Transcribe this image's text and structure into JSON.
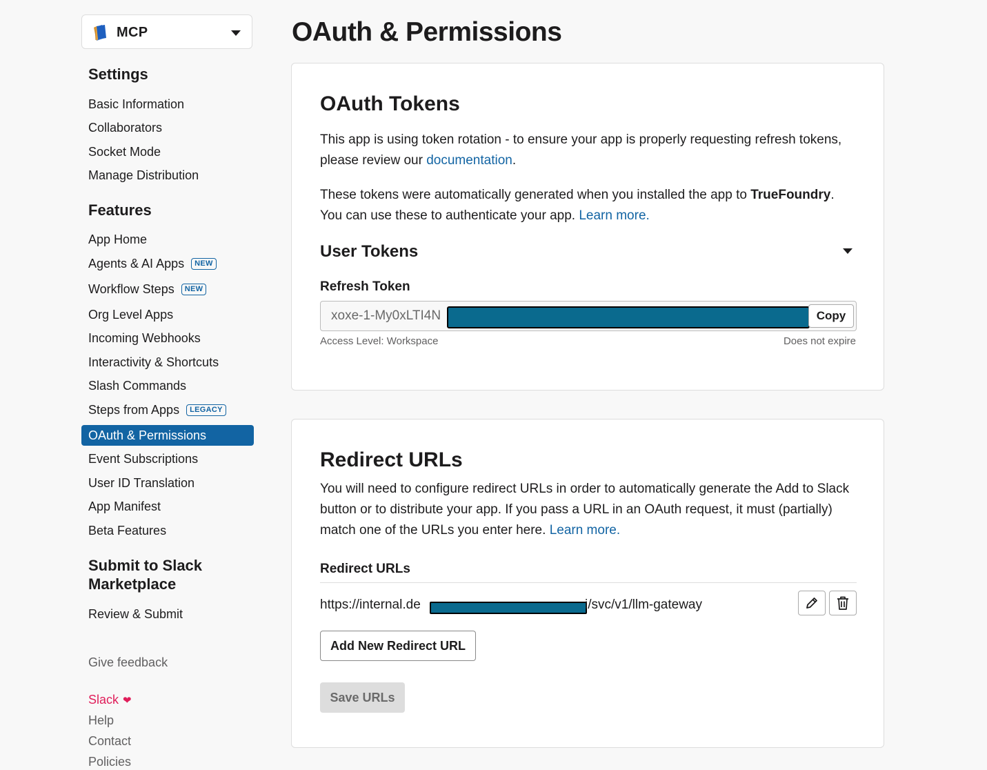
{
  "app_switcher": {
    "name": "MCP",
    "icon": "notebook-app-icon"
  },
  "sidebar": {
    "settings_heading": "Settings",
    "settings_items": [
      "Basic Information",
      "Collaborators",
      "Socket Mode",
      "Manage Distribution"
    ],
    "features_heading": "Features",
    "features_items": [
      {
        "label": "App Home"
      },
      {
        "label": "Agents & AI Apps",
        "badge": "NEW"
      },
      {
        "label": "Workflow Steps",
        "badge": "NEW"
      },
      {
        "label": "Org Level Apps"
      },
      {
        "label": "Incoming Webhooks"
      },
      {
        "label": "Interactivity & Shortcuts"
      },
      {
        "label": "Slash Commands"
      },
      {
        "label": "Steps from Apps",
        "badge": "LEGACY"
      },
      {
        "label": "OAuth & Permissions",
        "active": true
      },
      {
        "label": "Event Subscriptions"
      },
      {
        "label": "User ID Translation"
      },
      {
        "label": "App Manifest"
      },
      {
        "label": "Beta Features"
      }
    ],
    "marketplace_heading_line1": "Submit to Slack",
    "marketplace_heading_line2": "Marketplace",
    "marketplace_items": [
      "Review & Submit"
    ],
    "give_feedback": "Give feedback",
    "footer": {
      "slack": "Slack",
      "help": "Help",
      "contact": "Contact",
      "policies": "Policies"
    }
  },
  "page": {
    "title": "OAuth & Permissions"
  },
  "oauth_tokens": {
    "title": "OAuth Tokens",
    "rotation_text": "This app is using token rotation - to ensure your app is properly requesting refresh tokens, please review our ",
    "rotation_link": "documentation",
    "rotation_end": ".",
    "generated_text": "These tokens were automatically generated when you installed the app to ",
    "workspace_name": "TrueFoundry",
    "generated_text2": ". You can use these to authenticate your app. ",
    "learn_more": "Learn more.",
    "user_tokens_title": "User Tokens",
    "refresh_token_label": "Refresh Token",
    "refresh_token_value": "xoxe-1-My0xLTI4N",
    "copy_label": "Copy",
    "access_level": "Access Level: Workspace",
    "expiry": "Does not expire"
  },
  "redirect_urls": {
    "title": "Redirect URLs",
    "description": "You will need to configure redirect URLs in order to automatically generate the Add to Slack button or to distribute your app. If you pass a URL in an OAuth request, it must (partially) match one of the URLs you enter here. ",
    "learn_more": "Learn more.",
    "list_label": "Redirect URLs",
    "url_prefix": "https://internal.de",
    "url_suffix": "i/svc/v1/llm-gateway",
    "add_button": "Add New Redirect URL",
    "save_button": "Save URLs"
  },
  "colors": {
    "accent": "#1264a3",
    "redaction": "#0a6a8e",
    "slack_pink": "#e01e5a"
  }
}
